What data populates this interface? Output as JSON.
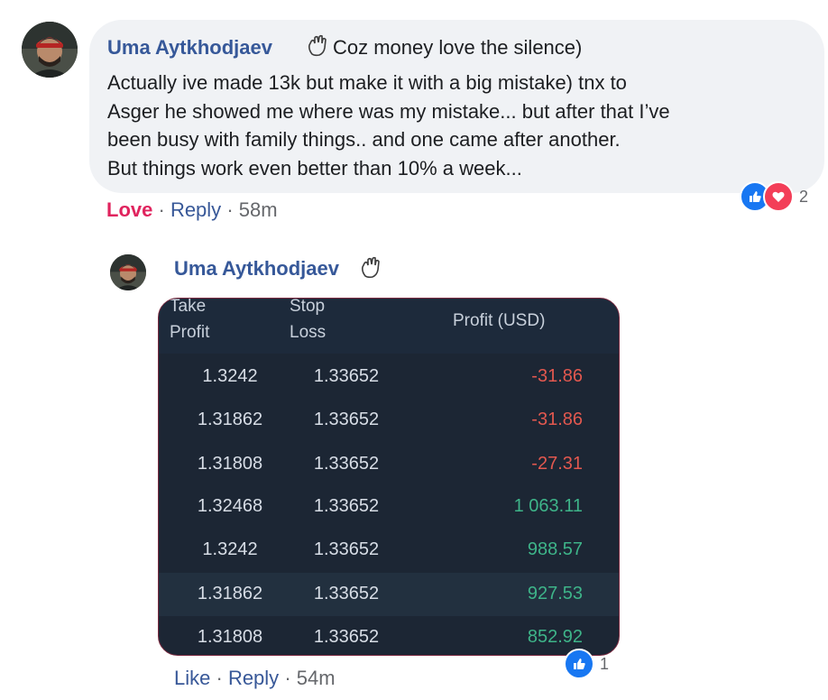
{
  "comment": {
    "author": "Uma Aytkhodjaev",
    "title": "Coz money love the silence)",
    "body": "Actually ive made 13k but make it with a big mistake) tnx to\nAsger he showed me where was my mistake... but after that I’ve\nbeen busy with family things.. and one came after another.\nBut things work even better than 10% a week...",
    "actions": {
      "love": "Love",
      "separator": "·",
      "reply": "Reply",
      "time": "58m"
    },
    "reactions": {
      "count": "2",
      "types": [
        "like-icon",
        "love-icon"
      ]
    }
  },
  "reply": {
    "author": "Uma Aytkhodjaev",
    "table": {
      "headers": {
        "take_profit_top": "Take",
        "take_profit_bottom": "Profit",
        "stop_loss_top": "Stop",
        "stop_loss_bottom": "Loss",
        "profit": "Profit (USD)"
      },
      "rows": [
        {
          "tp": "1.3242",
          "sl": "1.33652",
          "profit": "-31.86",
          "sign": "neg"
        },
        {
          "tp": "1.31862",
          "sl": "1.33652",
          "profit": "-31.86",
          "sign": "neg"
        },
        {
          "tp": "1.31808",
          "sl": "1.33652",
          "profit": "-27.31",
          "sign": "neg"
        },
        {
          "tp": "1.32468",
          "sl": "1.33652",
          "profit": "1 063.11",
          "sign": "pos"
        },
        {
          "tp": "1.3242",
          "sl": "1.33652",
          "profit": "988.57",
          "sign": "pos"
        },
        {
          "tp": "1.31862",
          "sl": "1.33652",
          "profit": "927.53",
          "sign": "pos"
        },
        {
          "tp": "1.31808",
          "sl": "1.33652",
          "profit": "852.92",
          "sign": "pos"
        }
      ]
    },
    "actions": {
      "like": "Like",
      "separator": "·",
      "reply": "Reply",
      "time": "54m"
    },
    "reactions": {
      "count": "1",
      "types": [
        "like-icon"
      ]
    }
  },
  "colors": {
    "link": "#365899",
    "love": "#e0245e",
    "like_blue": "#1877f2",
    "loss": "#e2584f",
    "gain": "#3eb489"
  }
}
